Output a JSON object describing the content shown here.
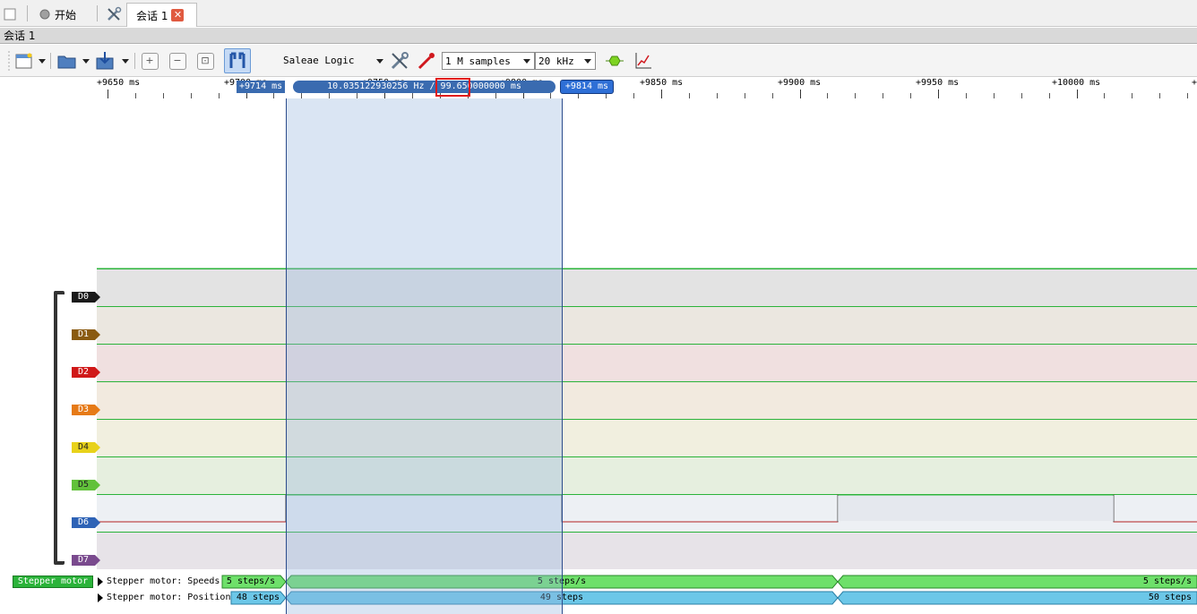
{
  "tabs": {
    "start_label": "开始",
    "session_label": "会话 1",
    "close_glyph": "✕"
  },
  "session_strip": {
    "title": "会话 1"
  },
  "toolbar": {
    "device_name": "Saleae Logic",
    "samples": "1 M samples",
    "rate": "20 kHz"
  },
  "ruler": {
    "ticks": [
      {
        "label": "+9650 ms"
      },
      {
        "label": "+9700 ms"
      },
      {
        "label": "+9750 ms"
      },
      {
        "label": "+9800 ms"
      },
      {
        "label": "+9850 ms"
      },
      {
        "label": "+9900 ms"
      },
      {
        "label": "+9950 ms"
      },
      {
        "label": "+10000 ms"
      }
    ],
    "marker_left": "+9714 ms",
    "measurement": "10.035122930256 Hz / 99.650000000 ms",
    "marker_right": "+9814 ms"
  },
  "channels": [
    {
      "id": "D0",
      "color": "#1a1a1a",
      "bg": "#e3e3e3"
    },
    {
      "id": "D1",
      "color": "#8a5a10",
      "bg": "#ebe7e0"
    },
    {
      "id": "D2",
      "color": "#d01818",
      "bg": "#f0e0e0"
    },
    {
      "id": "D3",
      "color": "#e67a17",
      "bg": "#f2eadf"
    },
    {
      "id": "D4",
      "color": "#e8d21a",
      "bg": "#f1efdf"
    },
    {
      "id": "D5",
      "color": "#61c13a",
      "bg": "#e6efdf"
    },
    {
      "id": "D6",
      "color": "#2e63b6",
      "bg": "#edf0f4"
    },
    {
      "id": "D7",
      "color": "#7a4a8e",
      "bg": "#e7e3e8"
    }
  ],
  "analyzer": {
    "name": "Stepper motor",
    "speeds": {
      "label": "Stepper motor: Speeds",
      "segments": [
        "5 steps/s",
        "5 steps/s",
        "5 steps/s"
      ]
    },
    "positions": {
      "label": "Stepper motor: Positions",
      "segments": [
        "48 steps",
        "49 steps",
        "50 steps"
      ]
    }
  },
  "colors": {
    "speeds_fill": "#6ee06a",
    "positions_fill": "#6cc7e8",
    "signal_low": "#b22222",
    "grid_line": "#2bb33a"
  }
}
